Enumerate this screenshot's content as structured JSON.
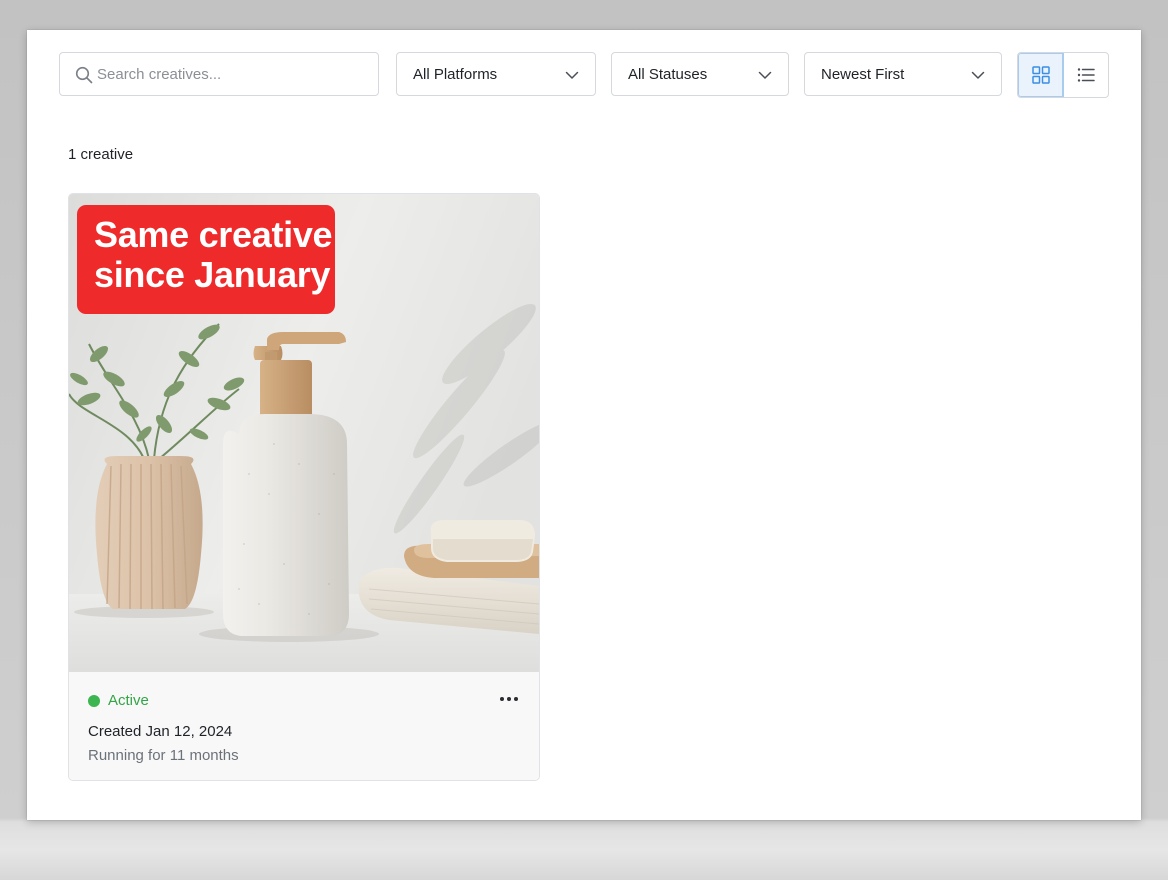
{
  "toolbar": {
    "search": {
      "placeholder": "Search creatives...",
      "value": ""
    },
    "platform_filter": {
      "selected": "All Platforms"
    },
    "status_filter": {
      "selected": "All Statuses"
    },
    "sort": {
      "selected": "Newest First"
    },
    "view_mode": {
      "active": "grid",
      "options": [
        "grid",
        "list"
      ]
    }
  },
  "results": {
    "count_label": "1 creative"
  },
  "creatives": [
    {
      "overlay_text": [
        "Same creative",
        "since January"
      ],
      "status": "Active",
      "created": "Created Jan 12, 2024",
      "running": "Running for 11 months"
    }
  ],
  "colors": {
    "accent": "#3a8ee6",
    "status_active": "#3db550",
    "overlay_badge": "#ee2a2a"
  },
  "icons": {
    "search": "search-icon",
    "dropdown": "chevron-down-icon",
    "grid_view": "grid-icon",
    "list_view": "list-icon",
    "more": "more-horizontal-icon"
  }
}
